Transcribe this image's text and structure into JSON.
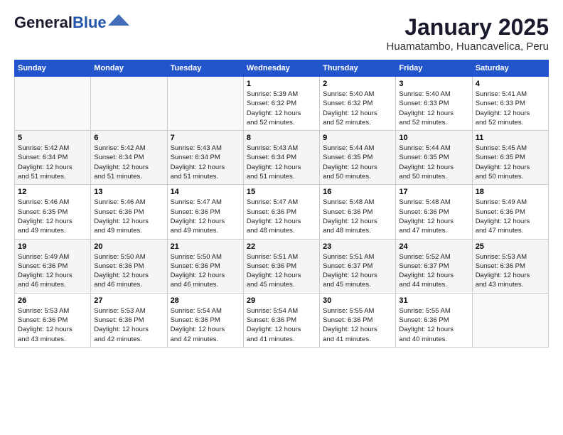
{
  "header": {
    "logo_line1": "General",
    "logo_line2": "Blue",
    "month": "January 2025",
    "location": "Huamatambo, Huancavelica, Peru"
  },
  "weekdays": [
    "Sunday",
    "Monday",
    "Tuesday",
    "Wednesday",
    "Thursday",
    "Friday",
    "Saturday"
  ],
  "weeks": [
    [
      {
        "day": "",
        "info": ""
      },
      {
        "day": "",
        "info": ""
      },
      {
        "day": "",
        "info": ""
      },
      {
        "day": "1",
        "info": "Sunrise: 5:39 AM\nSunset: 6:32 PM\nDaylight: 12 hours\nand 52 minutes."
      },
      {
        "day": "2",
        "info": "Sunrise: 5:40 AM\nSunset: 6:32 PM\nDaylight: 12 hours\nand 52 minutes."
      },
      {
        "day": "3",
        "info": "Sunrise: 5:40 AM\nSunset: 6:33 PM\nDaylight: 12 hours\nand 52 minutes."
      },
      {
        "day": "4",
        "info": "Sunrise: 5:41 AM\nSunset: 6:33 PM\nDaylight: 12 hours\nand 52 minutes."
      }
    ],
    [
      {
        "day": "5",
        "info": "Sunrise: 5:42 AM\nSunset: 6:34 PM\nDaylight: 12 hours\nand 51 minutes."
      },
      {
        "day": "6",
        "info": "Sunrise: 5:42 AM\nSunset: 6:34 PM\nDaylight: 12 hours\nand 51 minutes."
      },
      {
        "day": "7",
        "info": "Sunrise: 5:43 AM\nSunset: 6:34 PM\nDaylight: 12 hours\nand 51 minutes."
      },
      {
        "day": "8",
        "info": "Sunrise: 5:43 AM\nSunset: 6:34 PM\nDaylight: 12 hours\nand 51 minutes."
      },
      {
        "day": "9",
        "info": "Sunrise: 5:44 AM\nSunset: 6:35 PM\nDaylight: 12 hours\nand 50 minutes."
      },
      {
        "day": "10",
        "info": "Sunrise: 5:44 AM\nSunset: 6:35 PM\nDaylight: 12 hours\nand 50 minutes."
      },
      {
        "day": "11",
        "info": "Sunrise: 5:45 AM\nSunset: 6:35 PM\nDaylight: 12 hours\nand 50 minutes."
      }
    ],
    [
      {
        "day": "12",
        "info": "Sunrise: 5:46 AM\nSunset: 6:35 PM\nDaylight: 12 hours\nand 49 minutes."
      },
      {
        "day": "13",
        "info": "Sunrise: 5:46 AM\nSunset: 6:36 PM\nDaylight: 12 hours\nand 49 minutes."
      },
      {
        "day": "14",
        "info": "Sunrise: 5:47 AM\nSunset: 6:36 PM\nDaylight: 12 hours\nand 49 minutes."
      },
      {
        "day": "15",
        "info": "Sunrise: 5:47 AM\nSunset: 6:36 PM\nDaylight: 12 hours\nand 48 minutes."
      },
      {
        "day": "16",
        "info": "Sunrise: 5:48 AM\nSunset: 6:36 PM\nDaylight: 12 hours\nand 48 minutes."
      },
      {
        "day": "17",
        "info": "Sunrise: 5:48 AM\nSunset: 6:36 PM\nDaylight: 12 hours\nand 47 minutes."
      },
      {
        "day": "18",
        "info": "Sunrise: 5:49 AM\nSunset: 6:36 PM\nDaylight: 12 hours\nand 47 minutes."
      }
    ],
    [
      {
        "day": "19",
        "info": "Sunrise: 5:49 AM\nSunset: 6:36 PM\nDaylight: 12 hours\nand 46 minutes."
      },
      {
        "day": "20",
        "info": "Sunrise: 5:50 AM\nSunset: 6:36 PM\nDaylight: 12 hours\nand 46 minutes."
      },
      {
        "day": "21",
        "info": "Sunrise: 5:50 AM\nSunset: 6:36 PM\nDaylight: 12 hours\nand 46 minutes."
      },
      {
        "day": "22",
        "info": "Sunrise: 5:51 AM\nSunset: 6:36 PM\nDaylight: 12 hours\nand 45 minutes."
      },
      {
        "day": "23",
        "info": "Sunrise: 5:51 AM\nSunset: 6:37 PM\nDaylight: 12 hours\nand 45 minutes."
      },
      {
        "day": "24",
        "info": "Sunrise: 5:52 AM\nSunset: 6:37 PM\nDaylight: 12 hours\nand 44 minutes."
      },
      {
        "day": "25",
        "info": "Sunrise: 5:53 AM\nSunset: 6:36 PM\nDaylight: 12 hours\nand 43 minutes."
      }
    ],
    [
      {
        "day": "26",
        "info": "Sunrise: 5:53 AM\nSunset: 6:36 PM\nDaylight: 12 hours\nand 43 minutes."
      },
      {
        "day": "27",
        "info": "Sunrise: 5:53 AM\nSunset: 6:36 PM\nDaylight: 12 hours\nand 42 minutes."
      },
      {
        "day": "28",
        "info": "Sunrise: 5:54 AM\nSunset: 6:36 PM\nDaylight: 12 hours\nand 42 minutes."
      },
      {
        "day": "29",
        "info": "Sunrise: 5:54 AM\nSunset: 6:36 PM\nDaylight: 12 hours\nand 41 minutes."
      },
      {
        "day": "30",
        "info": "Sunrise: 5:55 AM\nSunset: 6:36 PM\nDaylight: 12 hours\nand 41 minutes."
      },
      {
        "day": "31",
        "info": "Sunrise: 5:55 AM\nSunset: 6:36 PM\nDaylight: 12 hours\nand 40 minutes."
      },
      {
        "day": "",
        "info": ""
      }
    ]
  ]
}
